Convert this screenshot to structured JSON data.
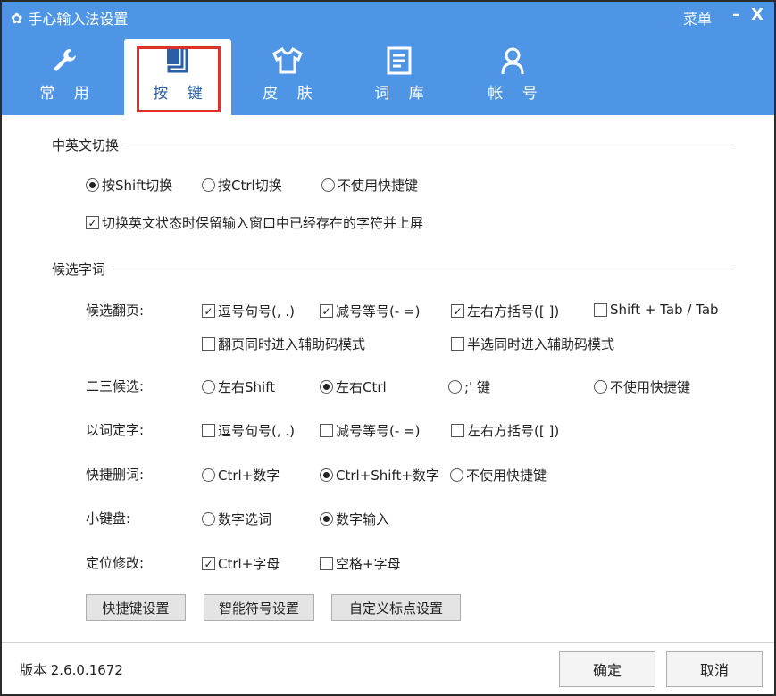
{
  "window": {
    "title": "手心输入法设置",
    "menu": "菜单",
    "minimize": "–",
    "close": "X"
  },
  "colors": {
    "accent": "#4f95e6",
    "highlight": "#e0302a"
  },
  "tabs": [
    {
      "label": "常 用",
      "icon": "wrench-icon"
    },
    {
      "label": "按 键",
      "icon": "key-icon",
      "active": true
    },
    {
      "label": "皮 肤",
      "icon": "shirt-icon"
    },
    {
      "label": "词 库",
      "icon": "document-icon"
    },
    {
      "label": "帐 号",
      "icon": "user-icon"
    }
  ],
  "section1": {
    "title": "中英文切换",
    "radios": [
      "按Shift切换",
      "按Ctrl切换",
      "不使用快捷键"
    ],
    "selected": 0,
    "checkbox": {
      "label": "切换英文状态时保留输入窗口中已经存在的字符并上屏",
      "checked": true
    }
  },
  "section2": {
    "title": "候选字词",
    "paging": {
      "label": "候选翻页:",
      "options": [
        {
          "label": "逗号句号(, .)",
          "checked": true
        },
        {
          "label": "减号等号(- =)",
          "checked": true
        },
        {
          "label": "左右方括号([ ])",
          "checked": true
        },
        {
          "label": "Shift + Tab / Tab",
          "checked": false
        },
        {
          "label": "翻页同时进入辅助码模式",
          "checked": false
        },
        {
          "label": "半选同时进入辅助码模式",
          "checked": false
        }
      ]
    },
    "second_third": {
      "label": "二三候选:",
      "options": [
        "左右Shift",
        "左右Ctrl",
        ";' 键",
        "不使用快捷键"
      ],
      "selected": 1
    },
    "word_to_char": {
      "label": "以词定字:",
      "options": [
        {
          "label": "逗号句号(, .)",
          "checked": false
        },
        {
          "label": "减号等号(- =)",
          "checked": false
        },
        {
          "label": "左右方括号([ ])",
          "checked": false
        }
      ]
    },
    "quick_delete": {
      "label": "快捷删词:",
      "options": [
        "Ctrl+数字",
        "Ctrl+Shift+数字",
        "不使用快捷键"
      ],
      "selected": 1
    },
    "numpad": {
      "label": "小键盘:",
      "options": [
        "数字选词",
        "数字输入"
      ],
      "selected": 1
    },
    "locate": {
      "label": "定位修改:",
      "options": [
        {
          "label": "Ctrl+字母",
          "checked": true
        },
        {
          "label": "空格+字母",
          "checked": false
        }
      ]
    }
  },
  "buttons": {
    "hotkey": "快捷键设置",
    "smart_symbol": "智能符号设置",
    "custom_punct": "自定义标点设置"
  },
  "footer": {
    "version": "版本 2.6.0.1672",
    "ok": "确定",
    "cancel": "取消"
  }
}
